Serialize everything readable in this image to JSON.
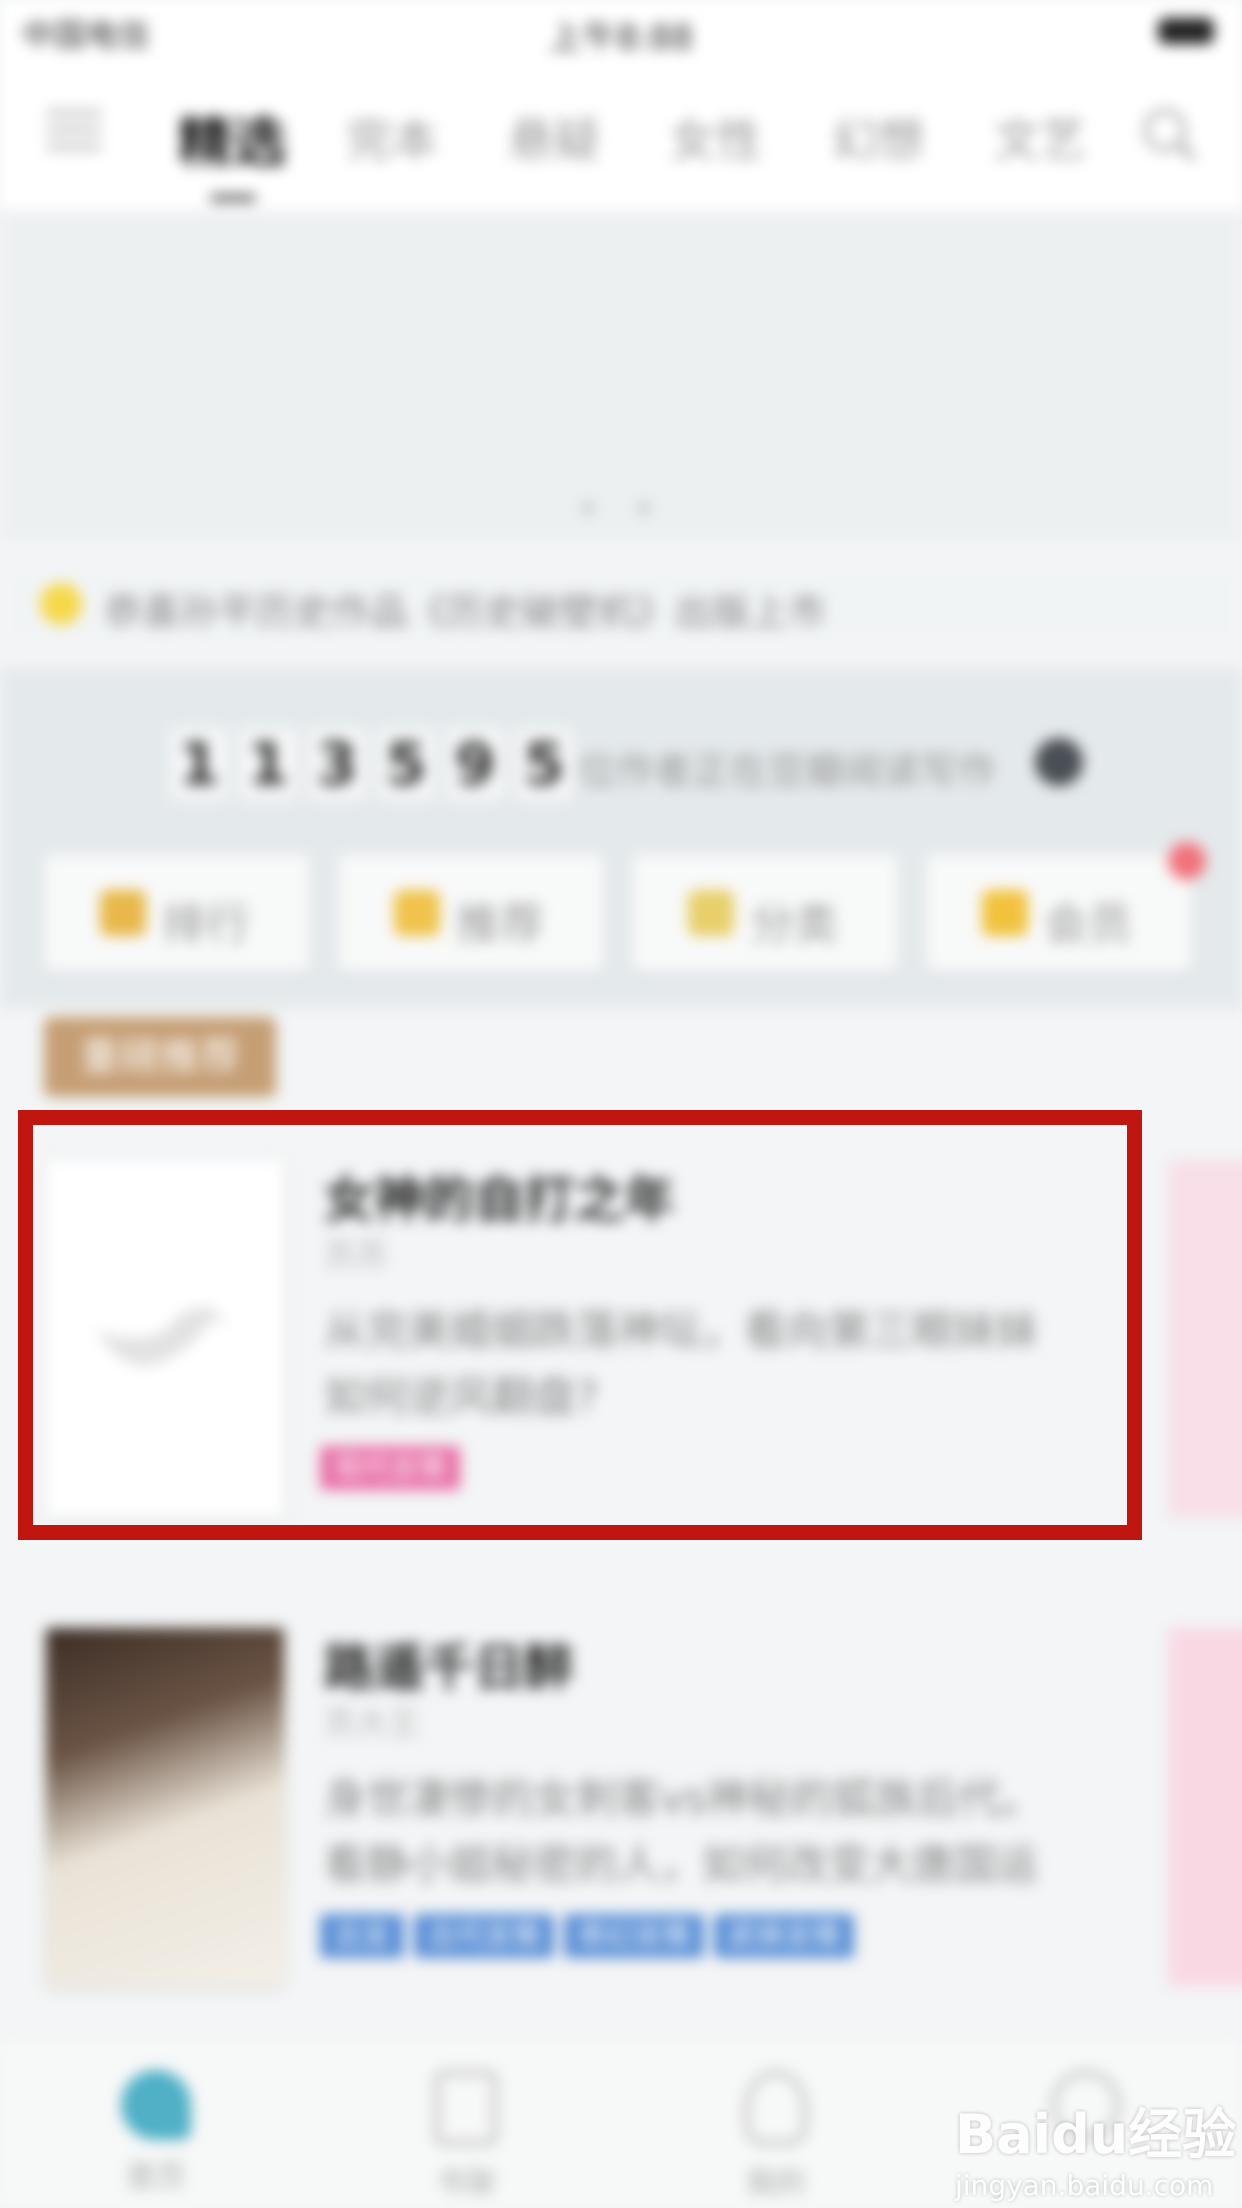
{
  "status": {
    "carrier": "中国电信",
    "time": "上午8:88"
  },
  "nav": {
    "tabs": [
      "精选",
      "完本",
      "悬疑",
      "女性",
      "幻想",
      "文艺"
    ],
    "active_index": 0
  },
  "announcement": {
    "text": "恭喜孙平历史作品《历史破壁机》出版上市"
  },
  "stats": {
    "digits": [
      "1",
      "1",
      "3",
      "5",
      "9",
      "5"
    ],
    "suffix": "位作者正在豆瓣阅读写作"
  },
  "quick_buttons": [
    {
      "label": "排行",
      "icon": "medal-icon",
      "color": "#e8b84a"
    },
    {
      "label": "推荐",
      "icon": "thumbs-up-icon",
      "color": "#f0c34a"
    },
    {
      "label": "分类",
      "icon": "category-icon",
      "color": "#e8cf6a"
    },
    {
      "label": "会员",
      "icon": "crown-icon",
      "color": "#f2c23c"
    }
  ],
  "section": {
    "label": "重磅推荐"
  },
  "books": [
    {
      "title": "女神的自打之年",
      "author": "苏苏",
      "desc": "从完美婚姻跌落神坛，看向第三眼妹妹如何逆风翻盘?",
      "tags": [
        {
          "label": "现代言情",
          "color": "#e86fa6"
        }
      ]
    },
    {
      "title": "路遥千日醉",
      "author": "苏大王",
      "desc": "身世凄惨的女刺客vs神秘的狐族后代。看静小姐秘密的人，如何改变大唐国运",
      "tags": [
        {
          "label": "古言",
          "color": "#5a8fd6"
        },
        {
          "label": "古代言情",
          "color": "#5a8fd6"
        },
        {
          "label": "奇幻言情",
          "color": "#5a8fd6"
        },
        {
          "label": "武侠言情",
          "color": "#5a8fd6"
        }
      ]
    }
  ],
  "bottom_nav": [
    {
      "label": "首页",
      "active": true
    },
    {
      "label": "书架",
      "active": false
    },
    {
      "label": "我的",
      "active": false
    },
    {
      "label": "",
      "active": false
    }
  ],
  "watermark": {
    "brand": "Baidu经验",
    "url": "jingyan.baidu.com"
  }
}
